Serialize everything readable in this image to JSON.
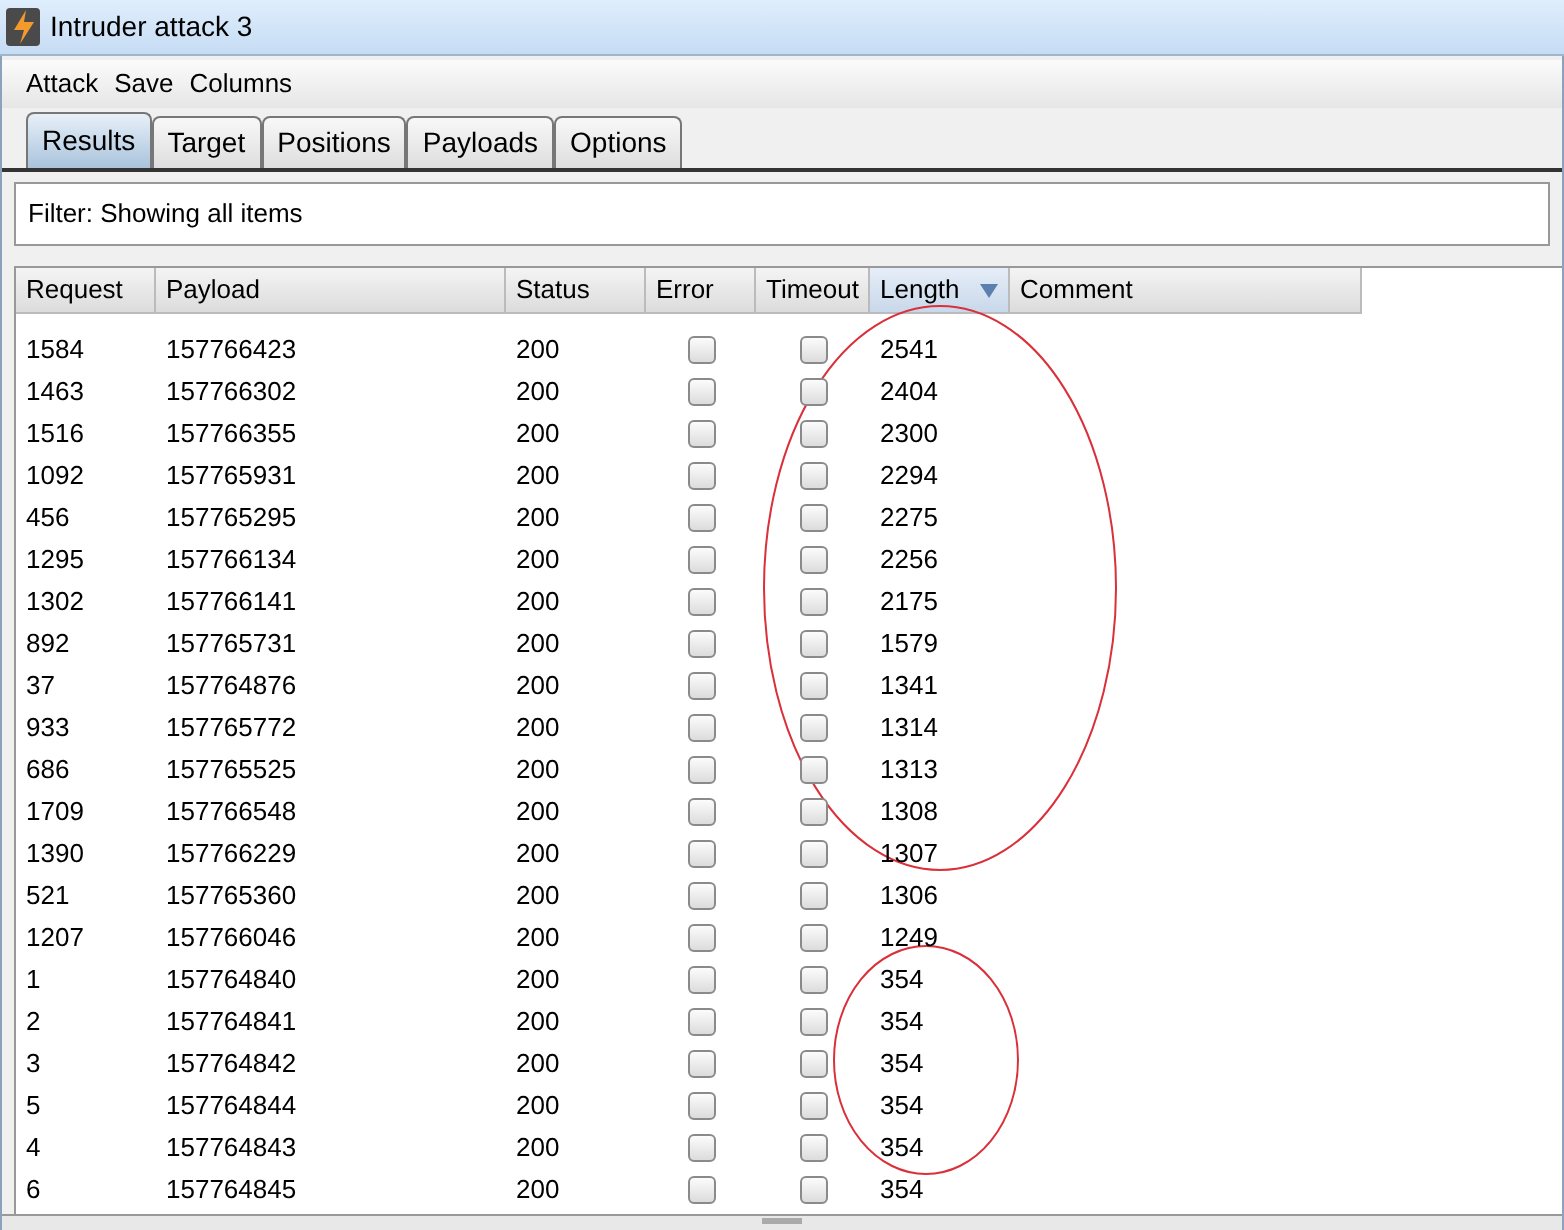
{
  "window": {
    "title": "Intruder attack 3"
  },
  "menu": [
    "Attack",
    "Save",
    "Columns"
  ],
  "tabs": [
    {
      "label": "Results",
      "selected": true
    },
    {
      "label": "Target",
      "selected": false
    },
    {
      "label": "Positions",
      "selected": false
    },
    {
      "label": "Payloads",
      "selected": false
    },
    {
      "label": "Options",
      "selected": false
    }
  ],
  "filter": "Filter: Showing all items",
  "table": {
    "columns": [
      {
        "label": "Request",
        "sorted": false
      },
      {
        "label": "Payload",
        "sorted": false
      },
      {
        "label": "Status",
        "sorted": false
      },
      {
        "label": "Error",
        "sorted": false
      },
      {
        "label": "Timeout",
        "sorted": false
      },
      {
        "label": "Length",
        "sorted": true
      },
      {
        "label": "Comment",
        "sorted": false
      }
    ],
    "rows": [
      {
        "request": "1584",
        "payload": "157766423",
        "status": "200",
        "error": false,
        "timeout": false,
        "length": "2541"
      },
      {
        "request": "1463",
        "payload": "157766302",
        "status": "200",
        "error": false,
        "timeout": false,
        "length": "2404"
      },
      {
        "request": "1516",
        "payload": "157766355",
        "status": "200",
        "error": false,
        "timeout": false,
        "length": "2300"
      },
      {
        "request": "1092",
        "payload": "157765931",
        "status": "200",
        "error": false,
        "timeout": false,
        "length": "2294"
      },
      {
        "request": "456",
        "payload": "157765295",
        "status": "200",
        "error": false,
        "timeout": false,
        "length": "2275"
      },
      {
        "request": "1295",
        "payload": "157766134",
        "status": "200",
        "error": false,
        "timeout": false,
        "length": "2256"
      },
      {
        "request": "1302",
        "payload": "157766141",
        "status": "200",
        "error": false,
        "timeout": false,
        "length": "2175"
      },
      {
        "request": "892",
        "payload": "157765731",
        "status": "200",
        "error": false,
        "timeout": false,
        "length": "1579"
      },
      {
        "request": "37",
        "payload": "157764876",
        "status": "200",
        "error": false,
        "timeout": false,
        "length": "1341"
      },
      {
        "request": "933",
        "payload": "157765772",
        "status": "200",
        "error": false,
        "timeout": false,
        "length": "1314"
      },
      {
        "request": "686",
        "payload": "157765525",
        "status": "200",
        "error": false,
        "timeout": false,
        "length": "1313"
      },
      {
        "request": "1709",
        "payload": "157766548",
        "status": "200",
        "error": false,
        "timeout": false,
        "length": "1308"
      },
      {
        "request": "1390",
        "payload": "157766229",
        "status": "200",
        "error": false,
        "timeout": false,
        "length": "1307"
      },
      {
        "request": "521",
        "payload": "157765360",
        "status": "200",
        "error": false,
        "timeout": false,
        "length": "1306"
      },
      {
        "request": "1207",
        "payload": "157766046",
        "status": "200",
        "error": false,
        "timeout": false,
        "length": "1249"
      },
      {
        "request": "1",
        "payload": "157764840",
        "status": "200",
        "error": false,
        "timeout": false,
        "length": "354"
      },
      {
        "request": "2",
        "payload": "157764841",
        "status": "200",
        "error": false,
        "timeout": false,
        "length": "354"
      },
      {
        "request": "3",
        "payload": "157764842",
        "status": "200",
        "error": false,
        "timeout": false,
        "length": "354"
      },
      {
        "request": "5",
        "payload": "157764844",
        "status": "200",
        "error": false,
        "timeout": false,
        "length": "354"
      },
      {
        "request": "4",
        "payload": "157764843",
        "status": "200",
        "error": false,
        "timeout": false,
        "length": "354"
      },
      {
        "request": "6",
        "payload": "157764845",
        "status": "200",
        "error": false,
        "timeout": false,
        "length": "354"
      }
    ]
  },
  "annotations": [
    {
      "kind": "ellipse"
    },
    {
      "kind": "ellipse"
    }
  ]
}
